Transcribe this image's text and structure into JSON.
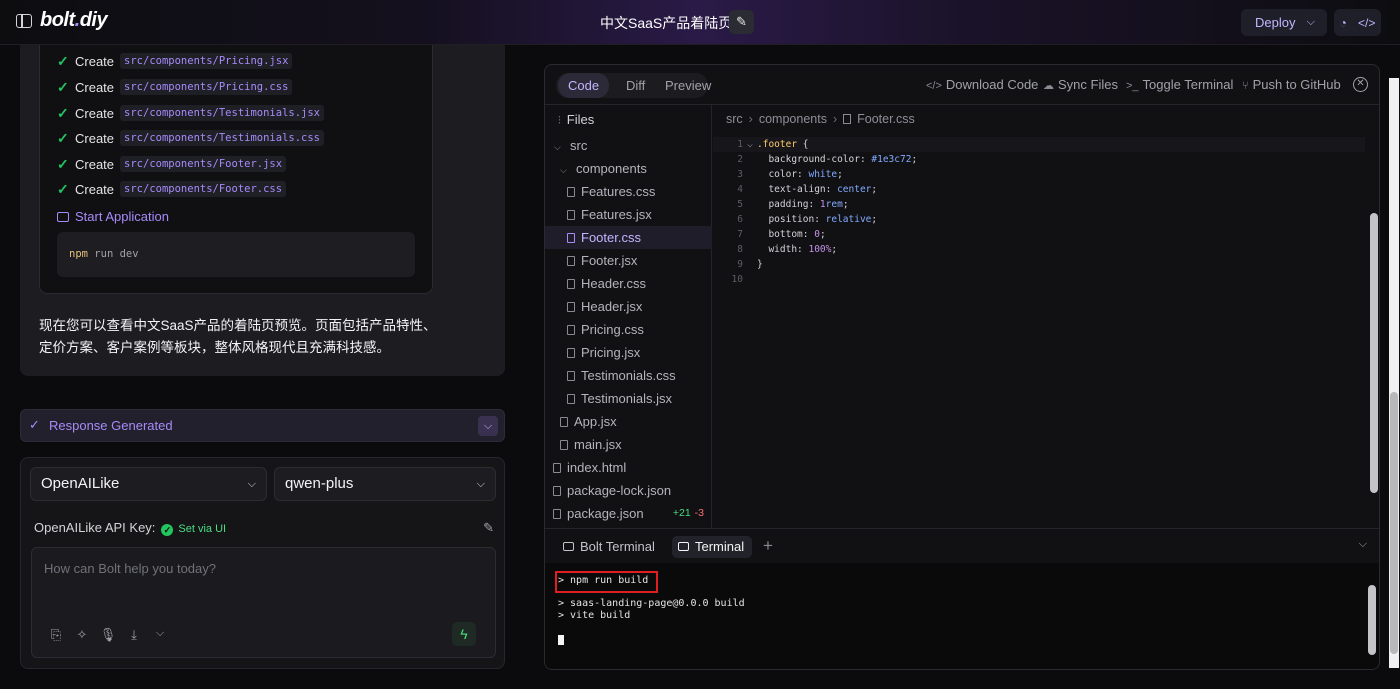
{
  "header": {
    "logo_text": "bolt",
    "logo_dot": ".",
    "logo_suffix": "diy",
    "project_title": "中文SaaS产品着陆页",
    "deploy_label": "Deploy"
  },
  "chat": {
    "actions": [
      {
        "verb": "Create",
        "path": "src/components/Pricing.jsx"
      },
      {
        "verb": "Create",
        "path": "src/components/Pricing.css"
      },
      {
        "verb": "Create",
        "path": "src/components/Testimonials.jsx"
      },
      {
        "verb": "Create",
        "path": "src/components/Testimonials.css"
      },
      {
        "verb": "Create",
        "path": "src/components/Footer.jsx"
      },
      {
        "verb": "Create",
        "path": "src/components/Footer.css"
      }
    ],
    "start_app_label": "Start Application",
    "command": {
      "bin": "npm",
      "args": "run dev"
    },
    "message_line1": "现在您可以查看中文SaaS产品的着陆页预览。页面包括产品特性、",
    "message_line2": "定价方案、客户案例等板块，整体风格现代且充满科技感。",
    "response_status": "Response Generated"
  },
  "input_panel": {
    "provider": "OpenAILike",
    "model": "qwen-plus",
    "api_key_label": "OpenAILike API Key:",
    "api_key_status": "Set via UI",
    "placeholder": "How can Bolt help you today?"
  },
  "workbench": {
    "view_tabs": [
      "Code",
      "Diff",
      "Preview"
    ],
    "active_view": "Code",
    "toolbar": {
      "download": "Download Code",
      "sync": "Sync Files",
      "toggle_terminal": "Toggle Terminal",
      "push": "Push to GitHub"
    },
    "files_header": "Files",
    "tree": [
      {
        "name": "src",
        "kind": "folder"
      },
      {
        "name": "components",
        "kind": "folder"
      },
      {
        "name": "Features.css",
        "kind": "file"
      },
      {
        "name": "Features.jsx",
        "kind": "file"
      },
      {
        "name": "Footer.css",
        "kind": "file",
        "selected": true
      },
      {
        "name": "Footer.jsx",
        "kind": "file"
      },
      {
        "name": "Header.css",
        "kind": "file"
      },
      {
        "name": "Header.jsx",
        "kind": "file"
      },
      {
        "name": "Pricing.css",
        "kind": "file"
      },
      {
        "name": "Pricing.jsx",
        "kind": "file"
      },
      {
        "name": "Testimonials.css",
        "kind": "file"
      },
      {
        "name": "Testimonials.jsx",
        "kind": "file"
      },
      {
        "name": "App.jsx",
        "kind": "file"
      },
      {
        "name": "main.jsx",
        "kind": "file"
      },
      {
        "name": "index.html",
        "kind": "file"
      },
      {
        "name": "package-lock.json",
        "kind": "file"
      },
      {
        "name": "package.json",
        "kind": "file",
        "additions": "+21",
        "deletions": "-3"
      }
    ],
    "breadcrumb": [
      "src",
      "components",
      "Footer.css"
    ],
    "code_lines": [
      ".footer {",
      "  background-color: #1e3c72;",
      "  color: white;",
      "  text-align: center;",
      "  padding: 1rem;",
      "  position: relative;",
      "  bottom: 0;",
      "  width: 100%;",
      "}",
      ""
    ],
    "terminal_tabs": [
      "Bolt Terminal",
      "Terminal"
    ],
    "active_terminal": "Terminal",
    "terminal_lines": [
      "> npm run build",
      "> saas-landing-page@0.0.0 build",
      "> vite build"
    ]
  }
}
